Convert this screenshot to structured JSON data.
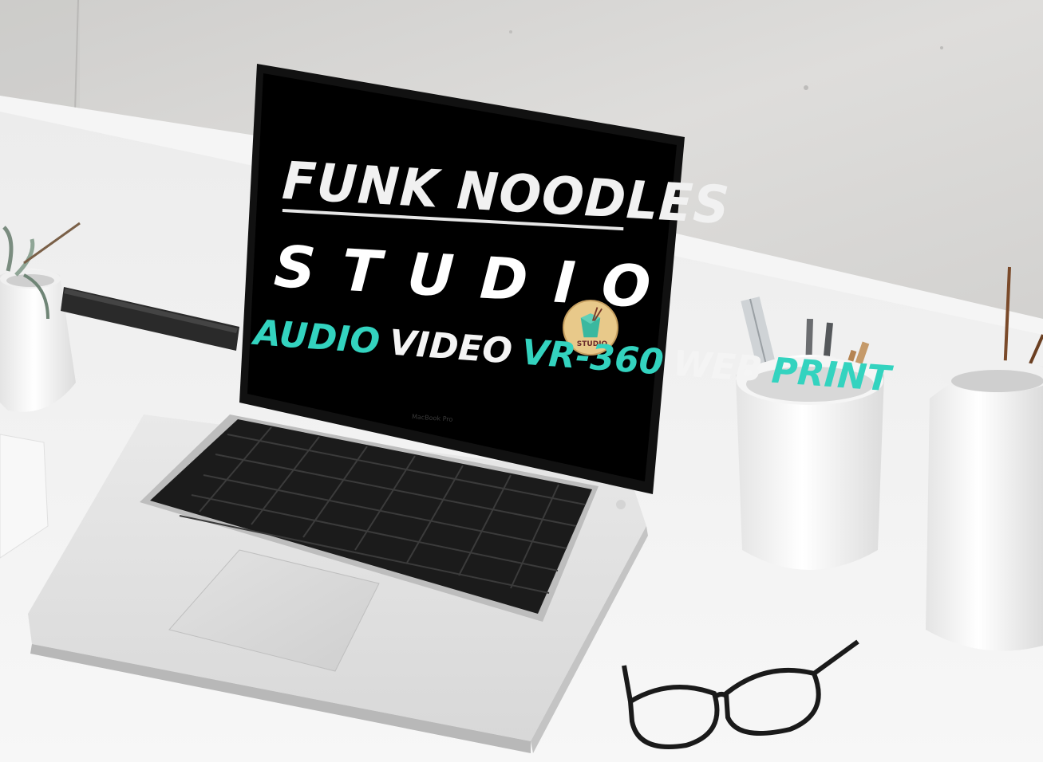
{
  "screen": {
    "line1": "FUNK NOODLES",
    "line2": "STUDIO",
    "services": [
      {
        "label": "AUDIO",
        "color": "teal"
      },
      {
        "label": "VIDEO",
        "color": "white"
      },
      {
        "label": "VR-360",
        "color": "teal"
      },
      {
        "label": "WEB",
        "color": "white"
      },
      {
        "label": "PRINT",
        "color": "teal"
      }
    ],
    "logo_text": "STUDIO"
  },
  "laptop": {
    "brand": "MacBook Pro"
  },
  "colors": {
    "teal": "#33d3bf",
    "screen_bg": "#000000",
    "desk": "#f3f3f3",
    "wall": "#d9d8d6"
  }
}
